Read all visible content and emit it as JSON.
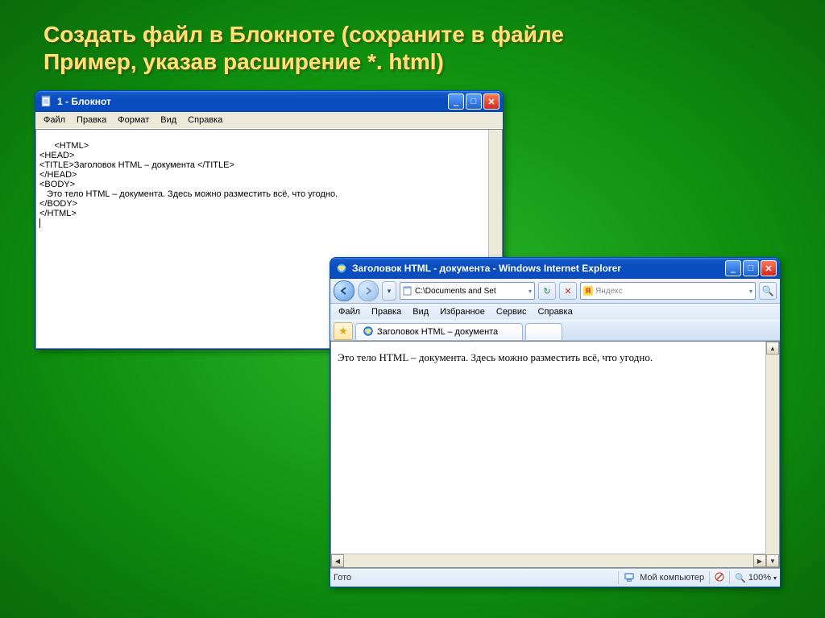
{
  "slide": {
    "title": "Создать файл в Блокноте (сохраните в файле\nПример,  указав расширение  *. html)"
  },
  "notepad": {
    "title": "1 - Блокнот",
    "menu": {
      "m1": "Файл",
      "m2": "Правка",
      "m3": "Формат",
      "m4": "Вид",
      "m5": "Справка"
    },
    "content": "<HTML>\n<HEAD>\n<TITLE>Заголовок HTML – документа </TITLE>\n</HEAD>\n<BODY>\n   Это тело HTML – документа. Здесь можно разместить всё, что угодно.\n</BODY>\n</HTML>\n"
  },
  "ie": {
    "title": "Заголовок HTML - документа - Windows Internet Explorer",
    "address": "C:\\Documents and Set",
    "search_placeholder": "Яндекс",
    "menu": {
      "m1": "Файл",
      "m2": "Правка",
      "m3": "Вид",
      "m4": "Избранное",
      "m5": "Сервис",
      "m6": "Справка"
    },
    "tab_label": "Заголовок HTML – документа",
    "body_text": "Это тело HTML – документа. Здесь можно разместить всё, что угодно.",
    "status_ready": "Гото",
    "status_zone": "Мой компьютер",
    "zoom": "100%"
  }
}
